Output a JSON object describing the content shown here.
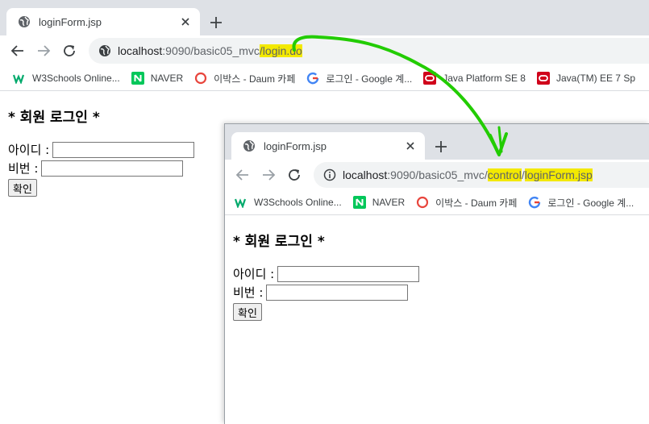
{
  "colors": {
    "tabstrip": "#dee1e6",
    "highlight": "#f3e900",
    "arrow": "#22cc00",
    "naver": "#03c75a",
    "oracle": "#d0021b"
  },
  "window1": {
    "tab": {
      "title": "loginForm.jsp",
      "favicon": "globe-icon"
    },
    "address": {
      "host": "localhost",
      "path_before": ":9090/basic05_mvc",
      "path_highlight": "/login.do"
    },
    "bookmarks": [
      {
        "label": "W3Schools Online...",
        "icon": "w3schools-icon"
      },
      {
        "label": "NAVER",
        "icon": "naver-icon"
      },
      {
        "label": "이박스 - Daum 카페",
        "icon": "daum-icon"
      },
      {
        "label": "로그인 - Google 계...",
        "icon": "google-icon"
      },
      {
        "label": "Java Platform SE 8",
        "icon": "oracle-icon"
      },
      {
        "label": "Java(TM) EE 7 Sp",
        "icon": "oracle-icon"
      }
    ],
    "page": {
      "heading": "* 회원 로그인 *",
      "id_label": "아이디 :",
      "pw_label": "비번 :",
      "submit_label": "확인"
    }
  },
  "window2": {
    "tab": {
      "title": "loginForm.jsp",
      "favicon": "globe-icon"
    },
    "address": {
      "host": "localhost",
      "path_before": ":9090/basic05_mvc/",
      "path_hl1": "control",
      "path_sep": "/",
      "path_hl2": "loginForm.jsp",
      "security_icon": "info-icon"
    },
    "bookmarks": [
      {
        "label": "W3Schools Online...",
        "icon": "w3schools-icon"
      },
      {
        "label": "NAVER",
        "icon": "naver-icon"
      },
      {
        "label": "이박스 - Daum 카페",
        "icon": "daum-icon"
      },
      {
        "label": "로그인 - Google 계...",
        "icon": "google-icon"
      }
    ],
    "page": {
      "heading": "* 회원 로그인 *",
      "id_label": "아이디 :",
      "pw_label": "비번 :",
      "submit_label": "확인"
    }
  }
}
